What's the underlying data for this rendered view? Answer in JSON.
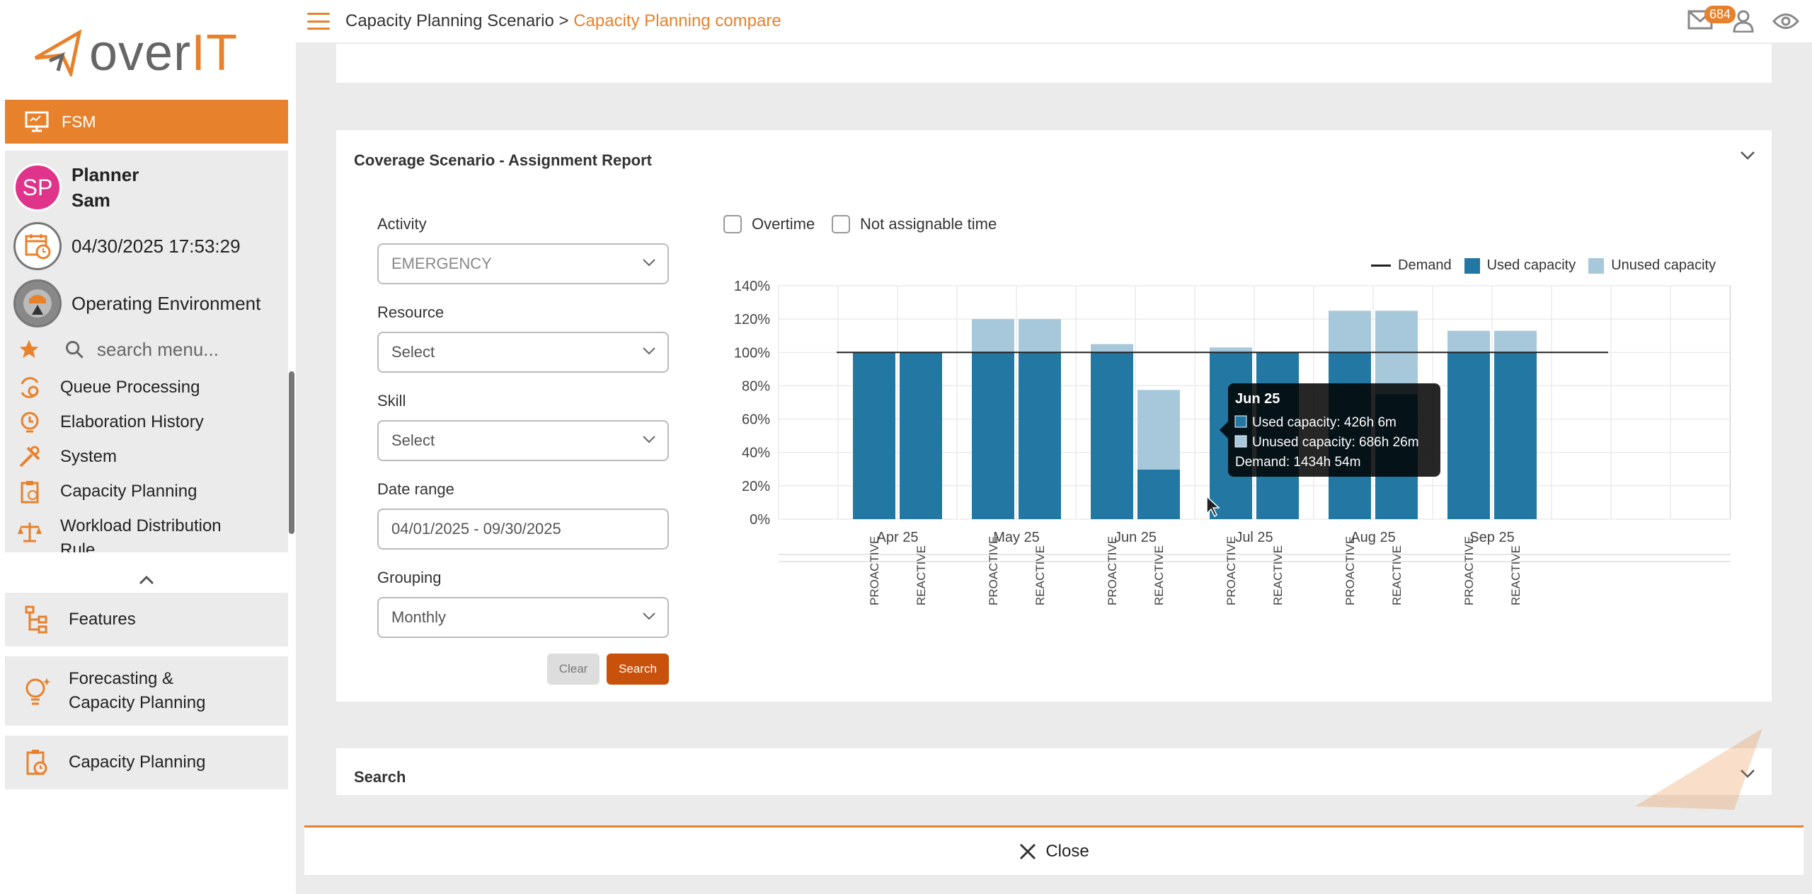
{
  "app": {
    "logo_text": "overIT",
    "module": "FSM"
  },
  "user": {
    "initials": "SP",
    "name_line1": "Planner",
    "name_line2": "Sam",
    "datetime": "04/30/2025 17:53:29",
    "environment": "Operating Environment"
  },
  "sidebar": {
    "search_placeholder": "search menu...",
    "items": [
      {
        "label": "Queue Processing",
        "icon": "queue-gear-icon"
      },
      {
        "label": "Elaboration History",
        "icon": "history-icon"
      },
      {
        "label": "System",
        "icon": "tools-icon"
      },
      {
        "label": "Capacity Planning",
        "icon": "clipboard-icon"
      },
      {
        "label": "Workload Distribution Rule",
        "icon": "scale-icon"
      }
    ],
    "sections": [
      {
        "label": "Features",
        "icon": "features-icon"
      },
      {
        "label_line1": "Forecasting &",
        "label_line2": "Capacity Planning",
        "icon": "lightbulb-icon"
      },
      {
        "label": "Capacity Planning",
        "icon": "clipboard-clock-icon"
      }
    ]
  },
  "header": {
    "breadcrumb_root": "Capacity Planning Scenario",
    "separator": ">",
    "breadcrumb_current": "Capacity Planning compare",
    "mail_count": "684"
  },
  "report": {
    "title": "Coverage Scenario - Assignment Report",
    "activity_label": "Activity",
    "activity_value": "EMERGENCY",
    "resource_label": "Resource",
    "resource_value": "Select",
    "skill_label": "Skill",
    "skill_value": "Select",
    "date_label": "Date range",
    "date_value": "04/01/2025 - 09/30/2025",
    "grouping_label": "Grouping",
    "grouping_value": "Monthly",
    "clear_label": "Clear",
    "search_label": "Search",
    "overtime_label": "Overtime",
    "not_assignable_label": "Not assignable time"
  },
  "chart_data": {
    "type": "bar",
    "stacked": true,
    "y_ticks": [
      "0%",
      "20%",
      "40%",
      "60%",
      "80%",
      "100%",
      "120%",
      "140%"
    ],
    "ylim": [
      0,
      140
    ],
    "months": [
      "Apr 25",
      "May 25",
      "Jun 25",
      "Jul 25",
      "Aug 25",
      "Sep 25"
    ],
    "groups": [
      "PROACTIVE",
      "REACTIVE"
    ],
    "legend": [
      "Demand",
      "Used capacity",
      "Unused capacity"
    ],
    "colors": {
      "used": "#2278a3",
      "unused": "#a7c8db",
      "demand": "#222222"
    },
    "demand": 100,
    "series": [
      {
        "name": "Used capacity",
        "values": [
          100,
          100,
          100,
          100,
          100,
          29.7,
          100,
          100,
          100,
          75,
          100,
          100
        ]
      },
      {
        "name": "Unused capacity",
        "values": [
          0,
          0,
          20,
          20,
          5,
          47.8,
          3,
          0,
          25,
          50,
          13,
          13
        ]
      }
    ],
    "tooltip": {
      "title": "Jun 25",
      "used": "Used capacity: 426h 6m",
      "unused": "Unused capacity: 686h 26m",
      "demand": "Demand: 1434h 54m"
    }
  },
  "search_section": {
    "title": "Search"
  },
  "footer": {
    "close_label": "Close"
  }
}
